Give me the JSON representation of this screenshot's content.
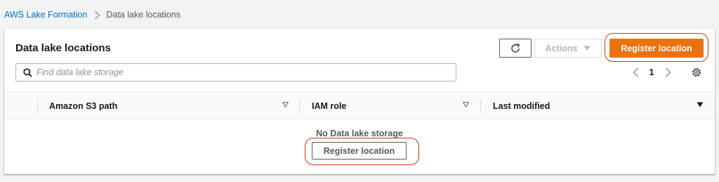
{
  "breadcrumb": {
    "root_label": "AWS Lake Formation",
    "current_label": "Data lake locations"
  },
  "panel": {
    "title": "Data lake locations",
    "actions_label": "Actions",
    "register_label": "Register location",
    "refresh_icon": "refresh-icon",
    "accent_color": "#ec7211"
  },
  "search": {
    "placeholder": "Find data lake storage",
    "value": ""
  },
  "pagination": {
    "current_page": "1"
  },
  "table": {
    "columns": [
      {
        "label": "Amazon S3 path",
        "sort": "sortable"
      },
      {
        "label": "IAM role",
        "sort": "sortable"
      },
      {
        "label": "Last modified",
        "sort": "descending"
      }
    ]
  },
  "empty_state": {
    "message": "No Data lake storage",
    "button_label": "Register location"
  },
  "annotations": {
    "highlight_color": "#d13212"
  }
}
